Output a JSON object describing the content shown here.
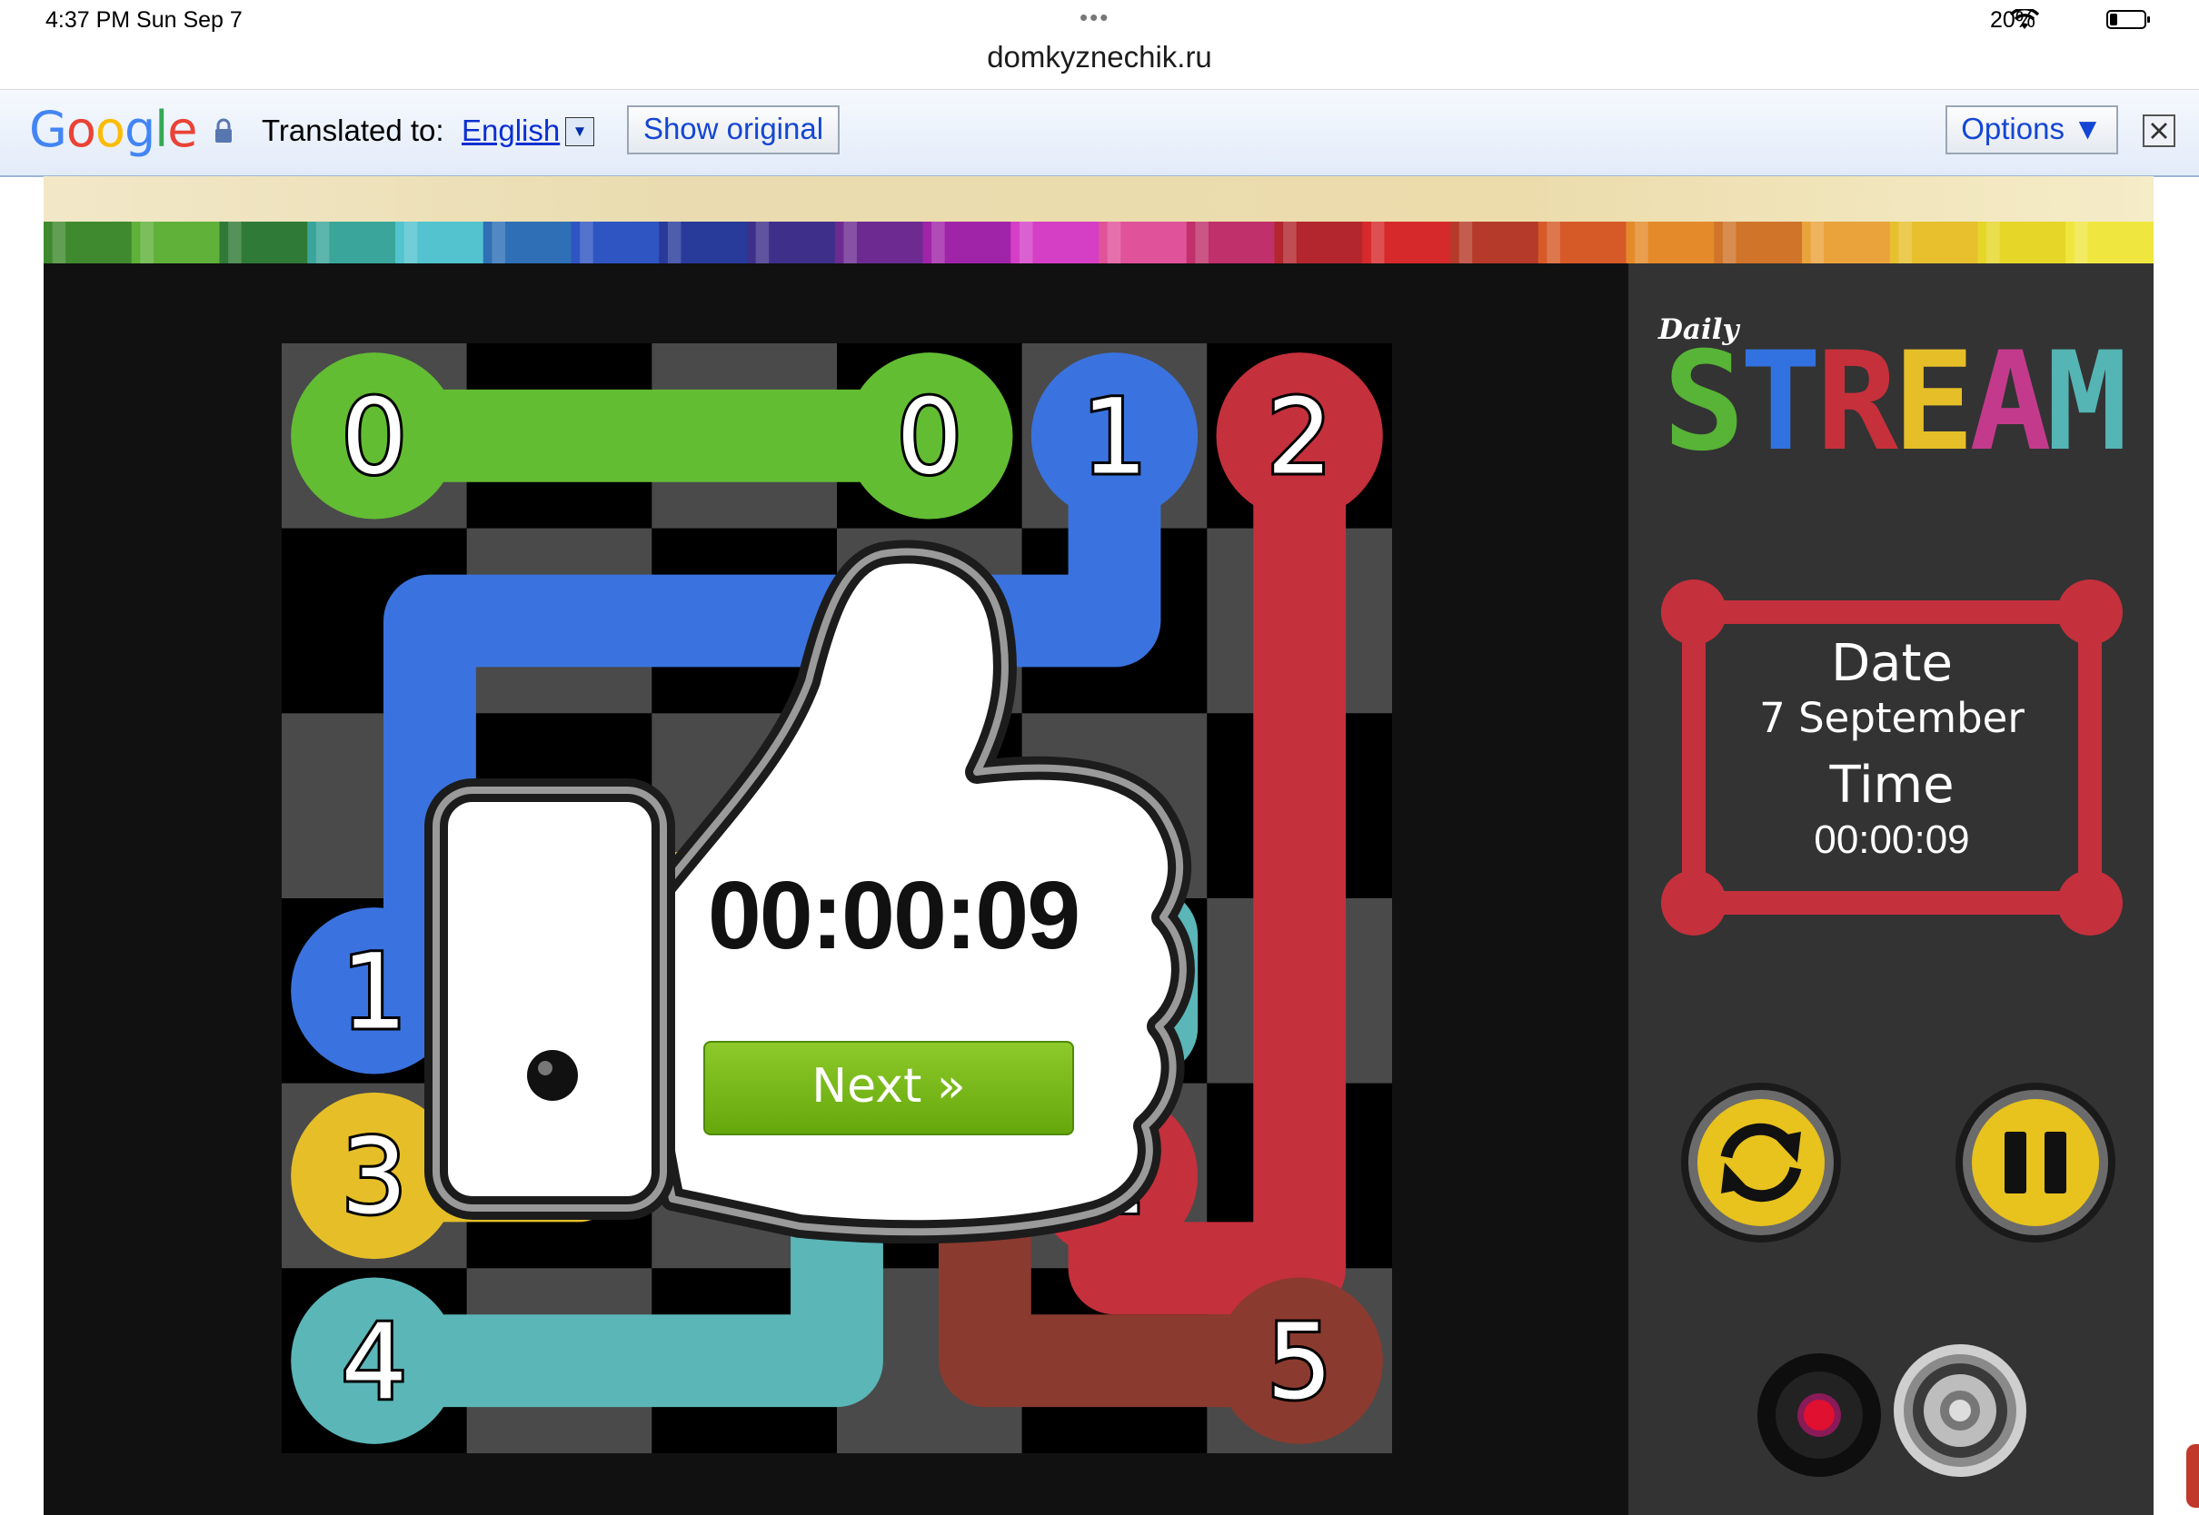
{
  "status_bar": {
    "time": "4:37 PM   Sun Sep 7",
    "dots": "•••",
    "battery": "20%"
  },
  "browser": {
    "url": "domkyznechik.ru"
  },
  "translate_bar": {
    "logo": "Google",
    "label": "Translated to:",
    "language": "English",
    "dropdown_glyph": "▼",
    "show_original": "Show original",
    "options": "Options ▼"
  },
  "game": {
    "logo_small": "Daily",
    "logo_main": "STREAM",
    "logo_colors": [
      "#57b436",
      "#3272e0",
      "#c6303b",
      "#e6bf28",
      "#c33a8c",
      "#55b5b5"
    ],
    "date_label": "Date",
    "date_value": "7 September",
    "time_label": "Time",
    "time_value": "00:00:09",
    "board": {
      "rows": 6,
      "cols": 6,
      "endpoints": [
        {
          "label": "0",
          "row": 0,
          "col": 0,
          "color": "#63bd33"
        },
        {
          "label": "0",
          "row": 0,
          "col": 3,
          "color": "#63bd33"
        },
        {
          "label": "1",
          "row": 0,
          "col": 4,
          "color": "#3a73df"
        },
        {
          "label": "2",
          "row": 0,
          "col": 5,
          "color": "#c4303c"
        },
        {
          "label": "1",
          "row": 3,
          "col": 0,
          "color": "#3a73df"
        },
        {
          "label": "3",
          "row": 4,
          "col": 0,
          "color": "#e6bf28"
        },
        {
          "label": "2",
          "row": 4,
          "col": 4,
          "color": "#c4303c"
        },
        {
          "label": "4",
          "row": 5,
          "col": 0,
          "color": "#5bb6b8"
        },
        {
          "label": "5",
          "row": 5,
          "col": 5,
          "color": "#8b3a2f"
        }
      ]
    }
  },
  "popup": {
    "time": "00:00:09",
    "next": "Next »"
  },
  "colors": {
    "green": "#63bd33",
    "blue": "#3a73df",
    "red": "#c4303c",
    "yellow": "#e6bf28",
    "teal": "#5bb6b8",
    "brown": "#8b3a2f",
    "panel": "#333333",
    "button_yellow": "#e8c21d"
  }
}
